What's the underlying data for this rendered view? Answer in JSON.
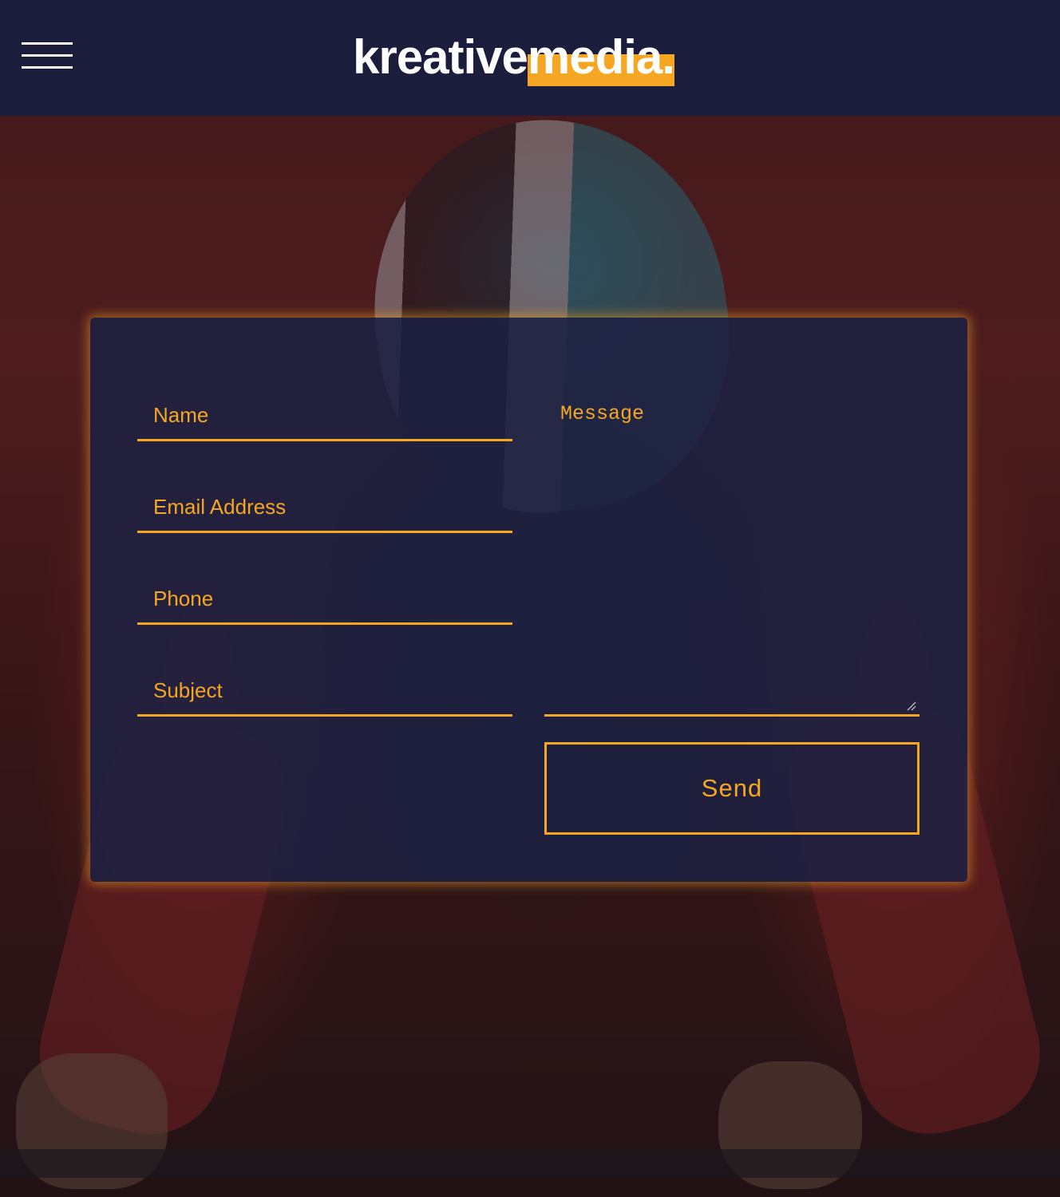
{
  "header": {
    "logo": {
      "part1": "kreative",
      "part2": "media."
    },
    "menu_icon": "hamburger-menu-icon"
  },
  "contact_form": {
    "name_placeholder": "Name",
    "email_placeholder": "Email Address",
    "phone_placeholder": "Phone",
    "subject_placeholder": "Subject",
    "message_placeholder": "Message",
    "send_label": "Send"
  },
  "colors": {
    "accent": "#f5a623",
    "header_bg": "#191f3e",
    "card_bg": "#1c2142",
    "text_light": "#ffffff"
  }
}
